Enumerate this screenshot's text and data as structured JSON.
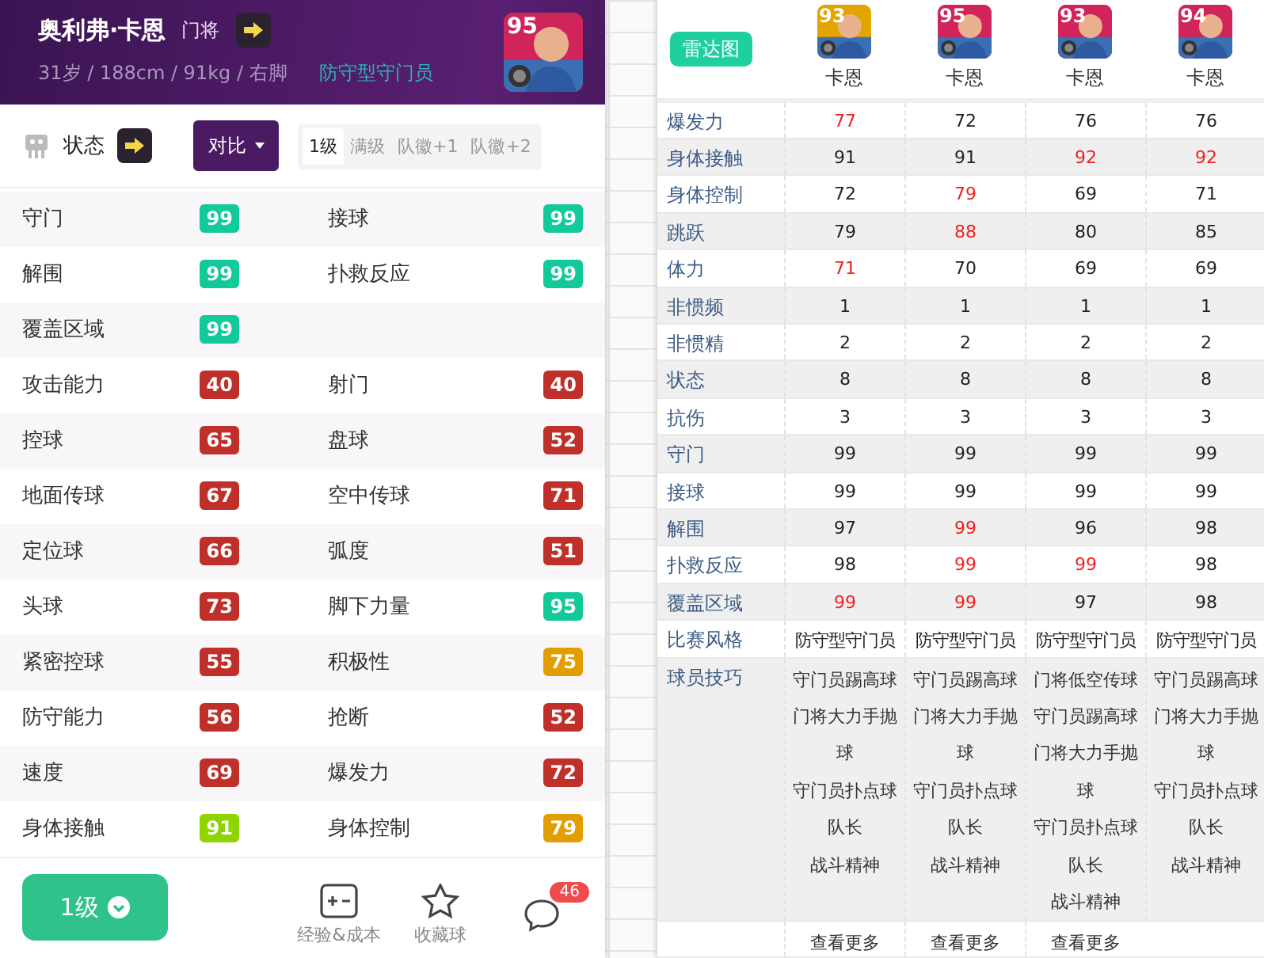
{
  "player": {
    "name": "奥利弗·卡恩",
    "position": "门将",
    "info": "31岁 / 188cm / 91kg / 右脚",
    "style": "防守型守门员",
    "rating": "95"
  },
  "toolbar": {
    "title": "状态",
    "compare": "对比",
    "levels": [
      {
        "label": "1级",
        "selected": true
      },
      {
        "label": "满级",
        "selected": false
      },
      {
        "label": "队徽+1",
        "selected": false
      },
      {
        "label": "队徽+2",
        "selected": false
      }
    ]
  },
  "stats": [
    [
      {
        "label": "守门",
        "value": "99",
        "color": "#12c99a"
      },
      {
        "label": "接球",
        "value": "99",
        "color": "#12c99a"
      }
    ],
    [
      {
        "label": "解围",
        "value": "99",
        "color": "#12c99a"
      },
      {
        "label": "扑救反应",
        "value": "99",
        "color": "#12c99a"
      }
    ],
    [
      {
        "label": "覆盖区域",
        "value": "99",
        "color": "#12c99a"
      }
    ],
    [
      {
        "label": "攻击能力",
        "value": "40",
        "color": "#c0302a"
      },
      {
        "label": "射门",
        "value": "40",
        "color": "#c0302a"
      }
    ],
    [
      {
        "label": "控球",
        "value": "65",
        "color": "#c0302a"
      },
      {
        "label": "盘球",
        "value": "52",
        "color": "#c0302a"
      }
    ],
    [
      {
        "label": "地面传球",
        "value": "67",
        "color": "#c0302a"
      },
      {
        "label": "空中传球",
        "value": "71",
        "color": "#c0302a"
      }
    ],
    [
      {
        "label": "定位球",
        "value": "66",
        "color": "#c0302a"
      },
      {
        "label": "弧度",
        "value": "51",
        "color": "#c0302a"
      }
    ],
    [
      {
        "label": "头球",
        "value": "73",
        "color": "#c0302a"
      },
      {
        "label": "脚下力量",
        "value": "95",
        "color": "#12c99a"
      }
    ],
    [
      {
        "label": "紧密控球",
        "value": "55",
        "color": "#c0302a"
      },
      {
        "label": "积极性",
        "value": "75",
        "color": "#e39d00"
      }
    ],
    [
      {
        "label": "防守能力",
        "value": "56",
        "color": "#c0302a"
      },
      {
        "label": "抢断",
        "value": "52",
        "color": "#c0302a"
      }
    ],
    [
      {
        "label": "速度",
        "value": "69",
        "color": "#c0302a"
      },
      {
        "label": "爆发力",
        "value": "72",
        "color": "#c0302a"
      }
    ],
    [
      {
        "label": "身体接触",
        "value": "91",
        "color": "#8ed400"
      },
      {
        "label": "身体控制",
        "value": "79",
        "color": "#e39d00"
      }
    ]
  ],
  "bottom": {
    "level_button": "1级",
    "actions": [
      {
        "kind": "calc",
        "label": "经验&成本"
      },
      {
        "kind": "star",
        "label": "收藏球"
      },
      {
        "kind": "chat",
        "badge": "46"
      }
    ]
  },
  "compare": {
    "radar_button": "雷达图",
    "players": [
      {
        "rating": "93",
        "name": "卡恩",
        "color": "#e3a400"
      },
      {
        "rating": "95",
        "name": "卡恩",
        "color": "#d0245a"
      },
      {
        "rating": "93",
        "name": "卡恩",
        "color": "#d0245a"
      },
      {
        "rating": "94",
        "name": "卡恩",
        "color": "#d0245a"
      }
    ],
    "rows": [
      {
        "label": "爆发力",
        "values": [
          {
            "text": "77",
            "best": true
          },
          {
            "text": "72",
            "best": false
          },
          {
            "text": "76",
            "best": false
          },
          {
            "text": "76",
            "best": false
          }
        ]
      },
      {
        "label": "身体接触",
        "values": [
          {
            "text": "91",
            "best": false
          },
          {
            "text": "91",
            "best": false
          },
          {
            "text": "92",
            "best": true
          },
          {
            "text": "92",
            "best": true
          }
        ]
      },
      {
        "label": "身体控制",
        "values": [
          {
            "text": "72",
            "best": false
          },
          {
            "text": "79",
            "best": true
          },
          {
            "text": "69",
            "best": false
          },
          {
            "text": "71",
            "best": false
          }
        ]
      },
      {
        "label": "跳跃",
        "values": [
          {
            "text": "79",
            "best": false
          },
          {
            "text": "88",
            "best": true
          },
          {
            "text": "80",
            "best": false
          },
          {
            "text": "85",
            "best": false
          }
        ]
      },
      {
        "label": "体力",
        "values": [
          {
            "text": "71",
            "best": true
          },
          {
            "text": "70",
            "best": false
          },
          {
            "text": "69",
            "best": false
          },
          {
            "text": "69",
            "best": false
          }
        ]
      },
      {
        "label": "非惯频",
        "values": [
          {
            "text": "1",
            "best": false
          },
          {
            "text": "1",
            "best": false
          },
          {
            "text": "1",
            "best": false
          },
          {
            "text": "1",
            "best": false
          }
        ]
      },
      {
        "label": "非惯精",
        "values": [
          {
            "text": "2",
            "best": false
          },
          {
            "text": "2",
            "best": false
          },
          {
            "text": "2",
            "best": false
          },
          {
            "text": "2",
            "best": false
          }
        ]
      },
      {
        "label": "状态",
        "values": [
          {
            "text": "8",
            "best": false
          },
          {
            "text": "8",
            "best": false
          },
          {
            "text": "8",
            "best": false
          },
          {
            "text": "8",
            "best": false
          }
        ]
      },
      {
        "label": "抗伤",
        "values": [
          {
            "text": "3",
            "best": false
          },
          {
            "text": "3",
            "best": false
          },
          {
            "text": "3",
            "best": false
          },
          {
            "text": "3",
            "best": false
          }
        ]
      },
      {
        "label": "守门",
        "values": [
          {
            "text": "99",
            "best": false
          },
          {
            "text": "99",
            "best": false
          },
          {
            "text": "99",
            "best": false
          },
          {
            "text": "99",
            "best": false
          }
        ]
      },
      {
        "label": "接球",
        "values": [
          {
            "text": "99",
            "best": false
          },
          {
            "text": "99",
            "best": false
          },
          {
            "text": "99",
            "best": false
          },
          {
            "text": "99",
            "best": false
          }
        ]
      },
      {
        "label": "解围",
        "values": [
          {
            "text": "97",
            "best": false
          },
          {
            "text": "99",
            "best": true
          },
          {
            "text": "96",
            "best": false
          },
          {
            "text": "98",
            "best": false
          }
        ]
      },
      {
        "label": "扑救反应",
        "values": [
          {
            "text": "98",
            "best": false
          },
          {
            "text": "99",
            "best": true
          },
          {
            "text": "99",
            "best": true
          },
          {
            "text": "98",
            "best": false
          }
        ]
      },
      {
        "label": "覆盖区域",
        "values": [
          {
            "text": "99",
            "best": true
          },
          {
            "text": "99",
            "best": true
          },
          {
            "text": "97",
            "best": false
          },
          {
            "text": "98",
            "best": false
          }
        ]
      }
    ],
    "style_row": {
      "label": "比赛风格",
      "values": [
        "防守型守门员",
        "防守型守门员",
        "防守型守门员",
        "防守型守门员"
      ]
    },
    "skills_row": {
      "label": "球员技巧",
      "values": [
        [
          "守门员踢高球",
          "门将大力手抛球",
          "守门员扑点球",
          "队长",
          "战斗精神"
        ],
        [
          "守门员踢高球",
          "门将大力手抛球",
          "守门员扑点球",
          "队长",
          "战斗精神"
        ],
        [
          "门将低空传球",
          "守门员踢高球",
          "门将大力手抛球",
          "守门员扑点球",
          "队长",
          "战斗精神"
        ],
        [
          "守门员踢高球",
          "门将大力手抛球",
          "守门员扑点球",
          "队长",
          "战斗精神"
        ]
      ]
    },
    "more_links": [
      "查看更多",
      "查看更多",
      "查看更多"
    ]
  }
}
